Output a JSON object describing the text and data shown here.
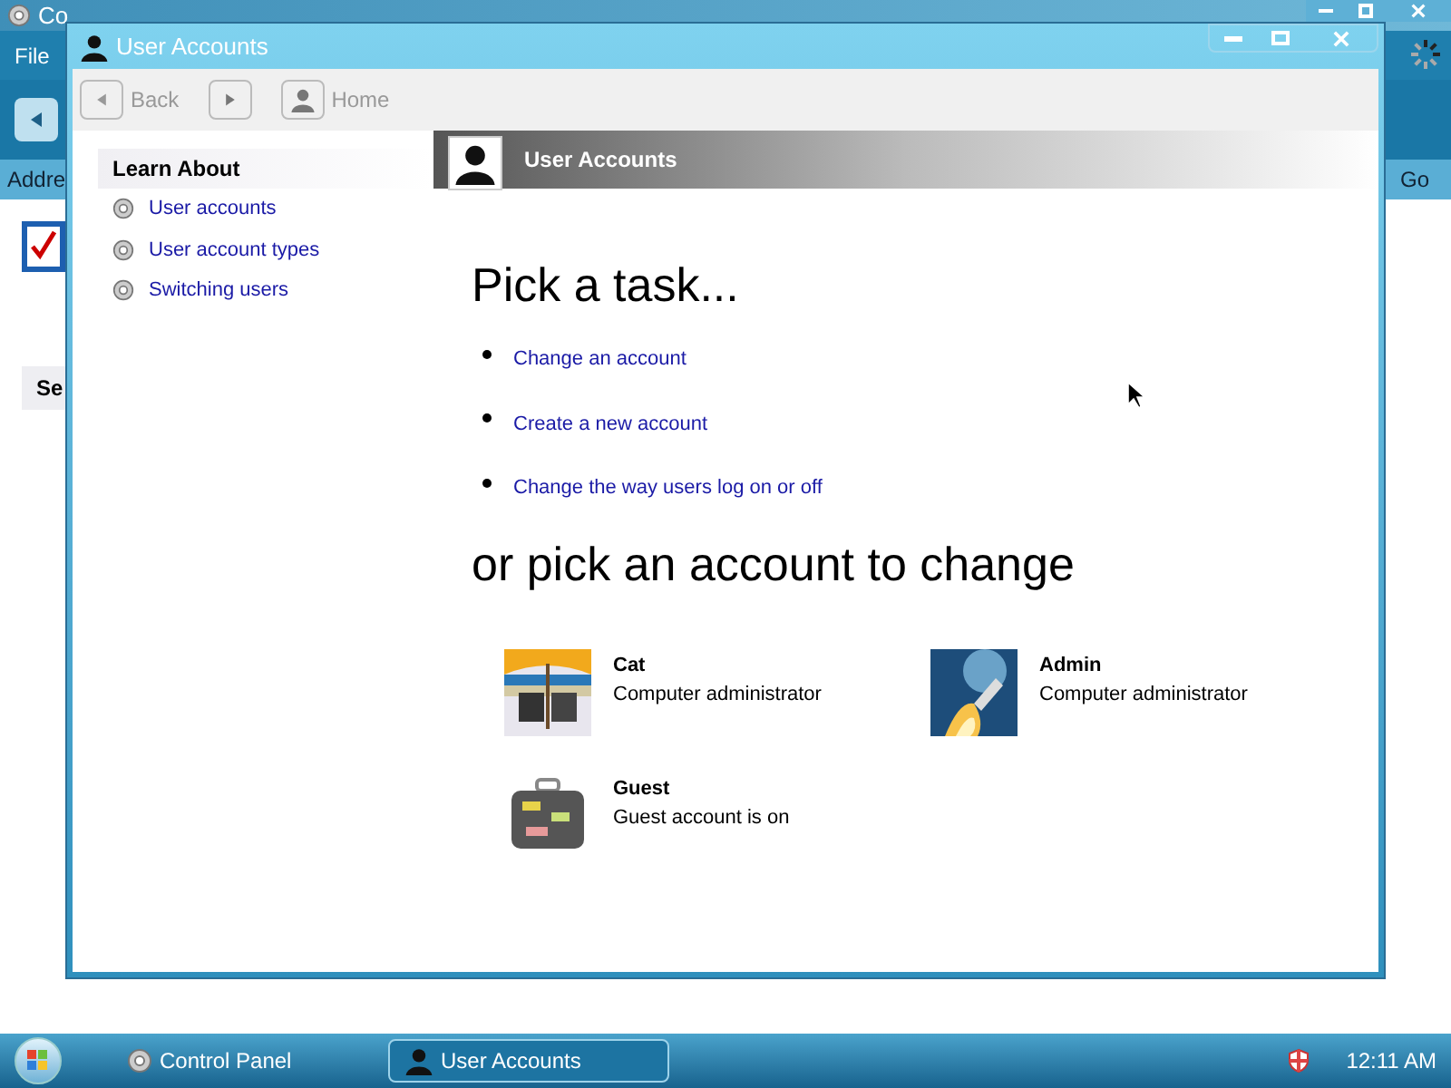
{
  "background_window": {
    "title": "Co",
    "menu": [
      "File"
    ],
    "address_label": "Addre",
    "go_button": "Go",
    "section_heading": "Se"
  },
  "window": {
    "title": "User Accounts"
  },
  "nav": {
    "back": "Back",
    "home": "Home"
  },
  "sidebar": {
    "heading": "Learn About",
    "items": [
      "User accounts",
      "User account types",
      "Switching users"
    ]
  },
  "banner": {
    "title": "User Accounts"
  },
  "tasks": {
    "heading": "Pick a task...",
    "items": [
      "Change an account",
      "Create a new account",
      "Change the way users log on or off"
    ]
  },
  "accounts": {
    "heading": "or pick an account to change",
    "items": [
      {
        "name": "Cat",
        "type": "Computer administrator",
        "kind": "beach"
      },
      {
        "name": "Admin",
        "type": "Computer administrator",
        "kind": "rocket"
      },
      {
        "name": "Guest",
        "type": "Guest account is on",
        "kind": "suitcase"
      }
    ]
  },
  "taskbar": {
    "items": [
      {
        "label": "Control Panel",
        "selected": false
      },
      {
        "label": "User Accounts",
        "selected": true
      }
    ],
    "clock": "12:11 AM"
  }
}
